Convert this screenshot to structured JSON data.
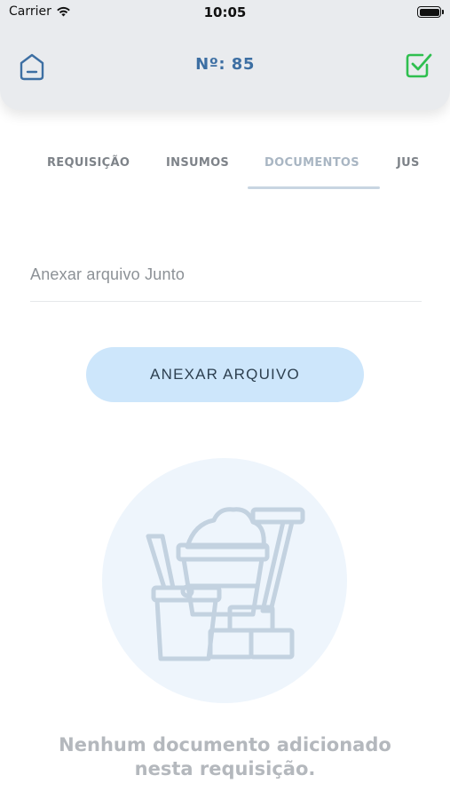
{
  "status_bar": {
    "carrier": "Carrier",
    "time": "10:05"
  },
  "header": {
    "title": "Nº: 85"
  },
  "tabs": [
    {
      "label": "REQUISIÇÃO",
      "active": false
    },
    {
      "label": "INSUMOS",
      "active": false
    },
    {
      "label": "DOCUMENTOS",
      "active": true
    },
    {
      "label": "JUS",
      "active": false
    }
  ],
  "form": {
    "attachment_label": "Anexar arquivo Junto"
  },
  "actions": {
    "attach_label": "ANEXAR ARQUIVO"
  },
  "empty_state": {
    "line1": "Nenhum documento adicionado",
    "line2": "nesta requisição."
  },
  "colors": {
    "accent": "#3d6fa3",
    "check": "#2fbf4f",
    "button_bg": "#cde6fb",
    "illustration": "#c3d2e0"
  }
}
